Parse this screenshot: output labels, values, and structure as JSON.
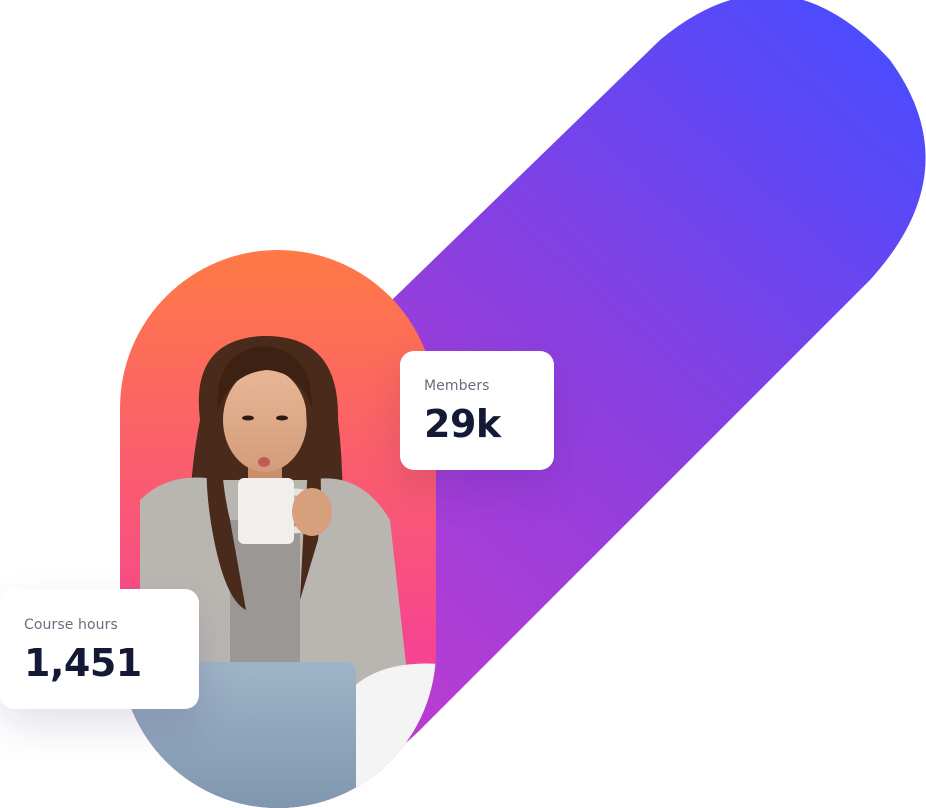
{
  "colors": {
    "ribbon_start": "#c03cd0",
    "ribbon_mid": "#8a3fdf",
    "ribbon_end": "#4a4cff",
    "capsule_top": "#ff7a45",
    "capsule_bottom": "#f53e9a",
    "card_label": "#6a6d80",
    "card_value": "#141a35"
  },
  "stats": {
    "members": {
      "label": "Members",
      "value": "29k"
    },
    "course_hours": {
      "label": "Course hours",
      "value": "1,451"
    }
  }
}
